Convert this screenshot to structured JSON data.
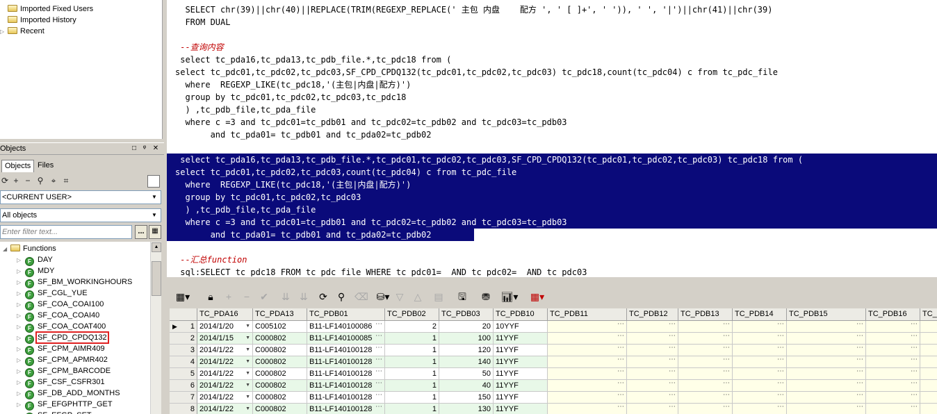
{
  "tree_top": {
    "items": [
      {
        "label": "Imported Fixed Users"
      },
      {
        "label": "Imported History"
      },
      {
        "label": "Recent"
      }
    ]
  },
  "objects_panel": {
    "title": "Objects",
    "tabs": [
      {
        "label": "Objects"
      },
      {
        "label": "Files"
      }
    ],
    "owner_combo": "<CURRENT USER>",
    "type_combo": "All objects",
    "filter_placeholder": "Enter filter text...",
    "filter_btn": "...",
    "folder_label": "Functions",
    "functions": [
      {
        "label": "DAY"
      },
      {
        "label": "MDY"
      },
      {
        "label": "SF_BM_WORKINGHOURS"
      },
      {
        "label": "SF_CGL_YUE"
      },
      {
        "label": "SF_COA_COAI100"
      },
      {
        "label": "SF_COA_COAI40"
      },
      {
        "label": "SF_COA_COAT400"
      },
      {
        "label": "SF_CPD_CPDQ132"
      },
      {
        "label": "SF_CPM_AIMR409"
      },
      {
        "label": "SF_CPM_APMR402"
      },
      {
        "label": "SF_CPM_BARCODE"
      },
      {
        "label": "SF_CSF_CSFR301"
      },
      {
        "label": "SF_DB_ADD_MONTHS"
      },
      {
        "label": "SF_EFGPHTTP_GET"
      },
      {
        "label": "SF_EFGP_SET"
      }
    ]
  },
  "editor": {
    "lines": [
      "  SELECT chr(39)||chr(40)||REPLACE(TRIM(REGEXP_REPLACE(' 主包 内盘    配方 ', ' [ ]+', ' ')), ' ', '|')||chr(41)||chr(39)",
      "  FROM DUAL",
      "",
      " --查询内容",
      " select tc_pda16,tc_pda13,tc_pdb_file.*,tc_pdc18 from (",
      "select tc_pdc01,tc_pdc02,tc_pdc03,SF_CPD_CPDQ132(tc_pdc01,tc_pdc02,tc_pdc03) tc_pdc18,count(tc_pdc04) c from tc_pdc_file",
      "  where  REGEXP_LIKE(tc_pdc18,'(主包|内盘|配方)')",
      "  group by tc_pdc01,tc_pdc02,tc_pdc03,tc_pdc18",
      "  ) ,tc_pdb_file,tc_pda_file",
      "  where c =3 and tc_pdc01=tc_pdb01 and tc_pdc02=tc_pdb02 and tc_pdc03=tc_pdb03",
      "       and tc_pda01= tc_pdb01 and tc_pda02=tc_pdb02",
      "",
      " select tc_pda16,tc_pda13,tc_pdb_file.*,tc_pdc01,tc_pdc02,tc_pdc03,SF_CPD_CPDQ132(tc_pdc01,tc_pdc02,tc_pdc03) tc_pdc18 from (",
      "select tc_pdc01,tc_pdc02,tc_pdc03,count(tc_pdc04) c from tc_pdc_file",
      "  where  REGEXP_LIKE(tc_pdc18,'(主包|内盘|配方)')",
      "  group by tc_pdc01,tc_pdc02,tc_pdc03",
      "  ) ,tc_pdb_file,tc_pda_file",
      "  where c =3 and tc_pdc01=tc_pdb01 and tc_pdc02=tc_pdb02 and tc_pdc03=tc_pdb03",
      "       and tc_pda01= tc_pdb01 and tc_pda02=tc_pdb02 ",
      "",
      " --汇总function",
      " sql:SELECT tc_pdc18 FROM tc_pdc_file WHERE tc_pdc01=  AND tc_pdc02=  AND tc_pdc03"
    ]
  },
  "grid": {
    "columns": [
      "TC_PDA16",
      "TC_PDA13",
      "TC_PDB01",
      "TC_PDB02",
      "TC_PDB03",
      "TC_PDB10",
      "TC_PDB11",
      "TC_PDB12",
      "TC_PDB13",
      "TC_PDB14",
      "TC_PDB15",
      "TC_PDB16",
      "TC_"
    ],
    "rows": [
      {
        "n": "1",
        "c": [
          "2014/1/20",
          "C005102",
          "B11-LF140100086",
          "2",
          "20",
          "10YYF"
        ]
      },
      {
        "n": "2",
        "c": [
          "2014/1/15",
          "C000802",
          "B11-LF140100085",
          "1",
          "100",
          "11YYF"
        ]
      },
      {
        "n": "3",
        "c": [
          "2014/1/22",
          "C000802",
          "B11-LF140100128",
          "1",
          "120",
          "11YYF"
        ]
      },
      {
        "n": "4",
        "c": [
          "2014/1/22",
          "C000802",
          "B11-LF140100128",
          "1",
          "140",
          "11YYF"
        ]
      },
      {
        "n": "5",
        "c": [
          "2014/1/22",
          "C000802",
          "B11-LF140100128",
          "1",
          "50",
          "11YYF"
        ]
      },
      {
        "n": "6",
        "c": [
          "2014/1/22",
          "C000802",
          "B11-LF140100128",
          "1",
          "40",
          "11YYF"
        ]
      },
      {
        "n": "7",
        "c": [
          "2014/1/22",
          "C000802",
          "B11-LF140100128",
          "1",
          "150",
          "11YYF"
        ]
      },
      {
        "n": "8",
        "c": [
          "2014/1/22",
          "C000802",
          "B11-LF140100128",
          "1",
          "130",
          "11YYF"
        ]
      }
    ]
  }
}
